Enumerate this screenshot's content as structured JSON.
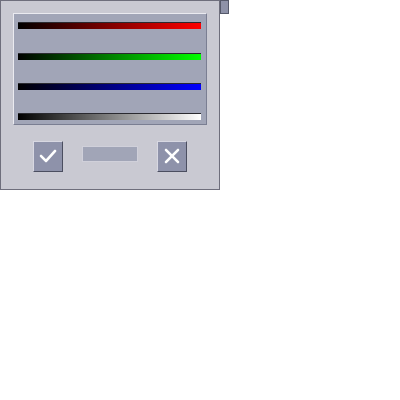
{
  "dialog": {
    "sliders": [
      {
        "channel": "red",
        "color": "#ff0000"
      },
      {
        "channel": "green",
        "color": "#00ff00"
      },
      {
        "channel": "blue",
        "color": "#0000ff"
      },
      {
        "channel": "gray",
        "color": "#ffffff"
      }
    ],
    "preview_color": "#a1a5b7",
    "ok_icon": "checkmark-icon",
    "cancel_icon": "close-icon"
  }
}
